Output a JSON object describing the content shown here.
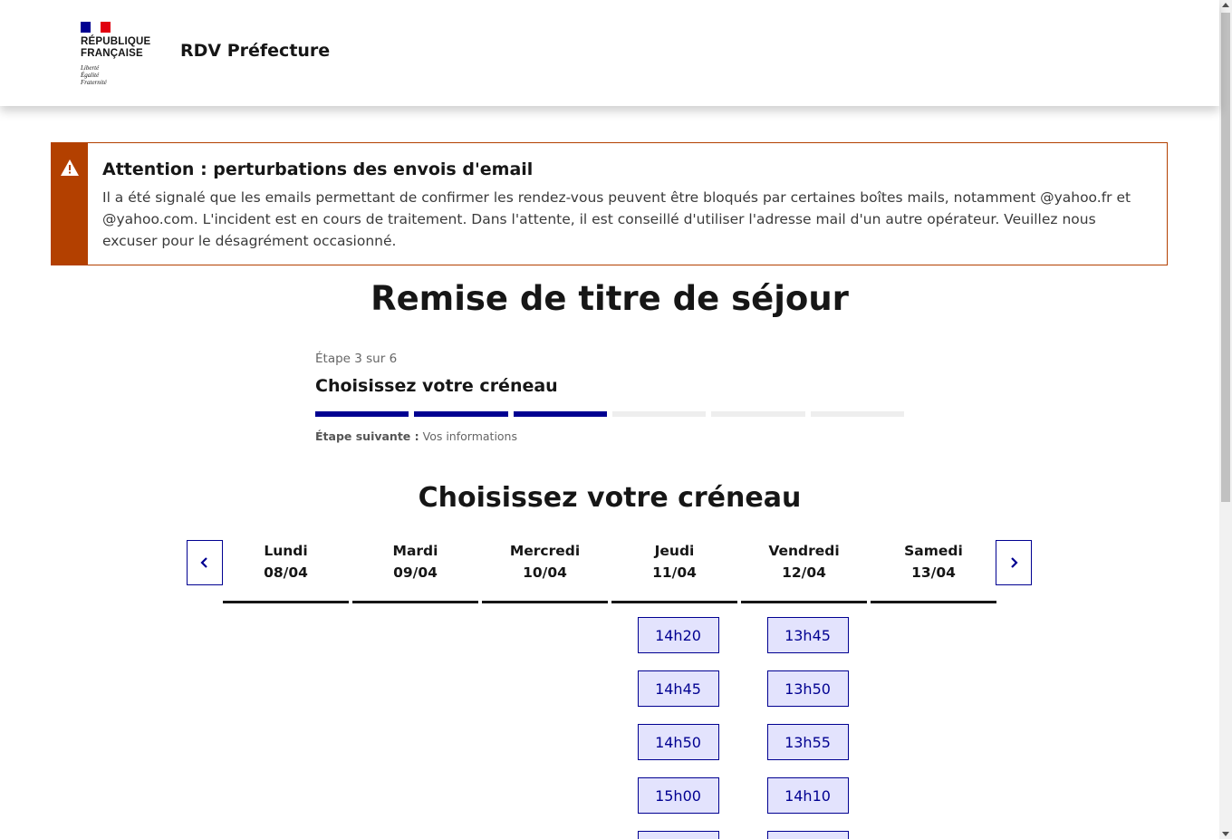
{
  "header": {
    "logo_line1": "RÉPUBLIQUE",
    "logo_line2": "FRANÇAISE",
    "motto_line1": "Liberté",
    "motto_line2": "Égalité",
    "motto_line3": "Fraternité",
    "service_title": "RDV Préfecture"
  },
  "alert": {
    "icon": "warning-icon",
    "title": "Attention : perturbations des envois d'email",
    "text": "Il a été signalé que les emails permettant de confirmer les rendez-vous peuvent être bloqués par certaines boîtes mails, notamment @yahoo.fr et @yahoo.com. L'incident est en cours de traitement. Dans l'attente, il est conseillé d'utiliser l'adresse mail d'un autre opérateur. Veuillez nous excuser pour le désagrément occasionné.",
    "color": "#b34000"
  },
  "main": {
    "title": "Remise de titre de séjour"
  },
  "stepper": {
    "state": "Étape 3 sur 6",
    "title": "Choisissez votre créneau",
    "current_step": 3,
    "total_steps": 6,
    "next_label": "Étape suivante :",
    "next_value": "Vos informations",
    "active_color": "#000091",
    "inactive_color": "#eeeeee"
  },
  "calendar": {
    "title": "Choisissez votre créneau",
    "prev_icon": "chevron-left-icon",
    "next_icon": "chevron-right-icon",
    "days": [
      {
        "name": "Lundi",
        "date": "08/04",
        "slots": []
      },
      {
        "name": "Mardi",
        "date": "09/04",
        "slots": []
      },
      {
        "name": "Mercredi",
        "date": "10/04",
        "slots": []
      },
      {
        "name": "Jeudi",
        "date": "11/04",
        "slots": [
          "14h20",
          "14h45",
          "14h50",
          "15h00",
          ""
        ]
      },
      {
        "name": "Vendredi",
        "date": "12/04",
        "slots": [
          "13h45",
          "13h50",
          "13h55",
          "14h10",
          ""
        ]
      },
      {
        "name": "Samedi",
        "date": "13/04",
        "slots": []
      }
    ],
    "accent": "#000091",
    "slot_bg": "#e3e3fd"
  }
}
